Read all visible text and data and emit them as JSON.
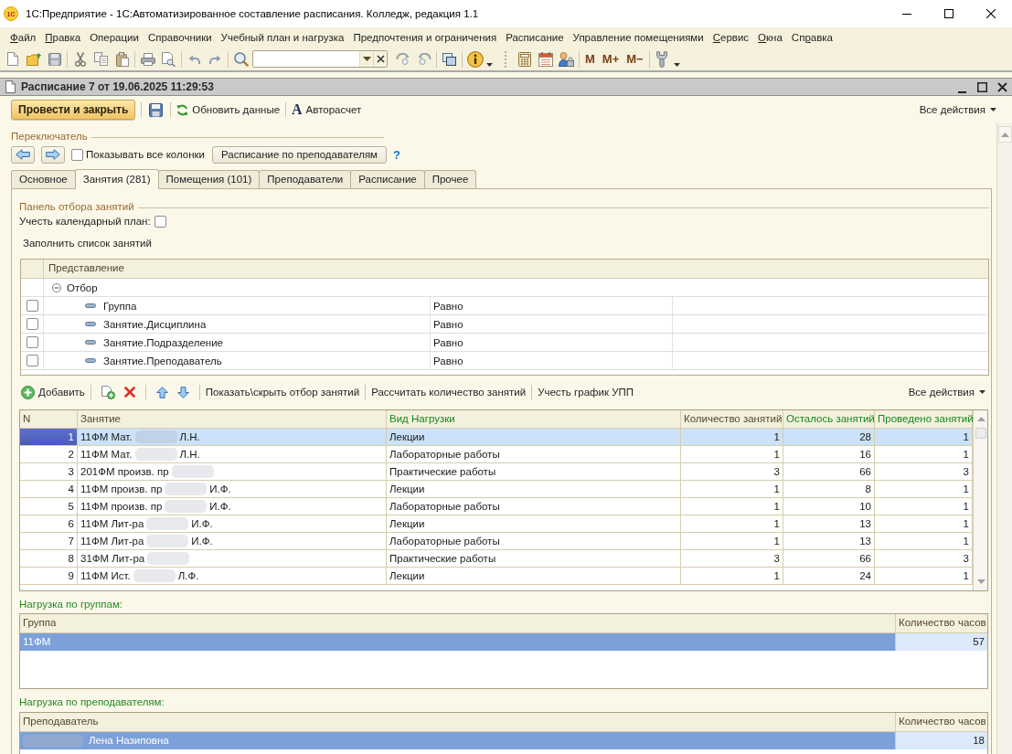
{
  "window": {
    "logo": "1С",
    "title": "1С:Предприятие - 1С:Автоматизированное составление расписания. Колледж, редакция 1.1"
  },
  "menu": [
    {
      "accel": "Ф",
      "rest": "айл"
    },
    {
      "accel": "П",
      "rest": "равка"
    },
    {
      "label": "Операции"
    },
    {
      "label": "Справочники"
    },
    {
      "label": "Учебный план и нагрузка"
    },
    {
      "label": "Предпочтения и ограничения"
    },
    {
      "label": "Расписание"
    },
    {
      "label": "Управление помещениями"
    },
    {
      "accel": "С",
      "rest": "ервис"
    },
    {
      "accel": "О",
      "rest": "кна"
    },
    {
      "lead": "Сп",
      "accel": "р",
      "rest": "авка"
    }
  ],
  "toolbar": {
    "memory_buttons": [
      "M",
      "M+",
      "M−"
    ]
  },
  "document": {
    "title": "Расписание 7 от 19.06.2025 11:29:53"
  },
  "command_bar": {
    "post_and_close": "Провести и закрыть",
    "refresh": "Обновить данные",
    "autocalc": {
      "glyph": "A",
      "label": "Авторасчет"
    },
    "all_actions": "Все действия"
  },
  "switcher": {
    "title": "Переключатель",
    "show_all_columns": {
      "label": "Показывать все колонки",
      "checked": false
    },
    "teacher_schedule": "Расписание по преподавателям",
    "help": "?"
  },
  "tabs": [
    {
      "label": "Основное",
      "selected": false
    },
    {
      "label": "Занятия (281)",
      "selected": true
    },
    {
      "label": "Помещения (101)",
      "selected": false
    },
    {
      "label": "Преподаватели",
      "selected": false
    },
    {
      "label": "Расписание",
      "selected": false
    },
    {
      "label": "Прочее",
      "selected": false
    }
  ],
  "filter_panel": {
    "title": "Панель отбора занятий",
    "calendar_plan": {
      "label": "Учесть календарный план:",
      "checked": false
    },
    "fill_button": "Заполнить список занятий",
    "table": {
      "columns": [
        "Представление"
      ],
      "group": {
        "label": "Отбор",
        "expanded": true
      },
      "rows": [
        {
          "checked": false,
          "field": "Группа",
          "comparison": "Равно"
        },
        {
          "checked": false,
          "field": "Занятие.Дисциплина",
          "comparison": "Равно"
        },
        {
          "checked": false,
          "field": "Занятие.Подразделение",
          "comparison": "Равно"
        },
        {
          "checked": false,
          "field": "Занятие.Преподаватель",
          "comparison": "Равно"
        }
      ]
    }
  },
  "lessons_toolbar": {
    "add": "Добавить",
    "show_hide": "Показать\\скрыть отбор занятий",
    "calculate": "Рассчитать количество занятий",
    "upp": "Учесть график УПП",
    "all_actions": "Все действия"
  },
  "lessons": {
    "columns": [
      {
        "label": "N",
        "color": "#54472c"
      },
      {
        "label": "Занятие",
        "color": "#54472c"
      },
      {
        "label": "Вид Нагрузки",
        "color": "#16891c"
      },
      {
        "label": "Количество занятий",
        "color": "#54472c"
      },
      {
        "label": "Осталось занятий",
        "color": "#16891c"
      },
      {
        "label": "Проведено занятий",
        "color": "#16891c"
      }
    ],
    "rows": [
      {
        "n": "1",
        "lesson": "11ФМ Мат.",
        "lesson_tail": "Л.Н.",
        "load_type": "Лекции",
        "count": "1",
        "remaining": "28",
        "done": "1",
        "selected": true
      },
      {
        "n": "2",
        "lesson": "11ФМ Мат.",
        "lesson_tail": "Л.Н.",
        "load_type": "Лабораторные работы",
        "count": "1",
        "remaining": "16",
        "done": "1",
        "selected": false
      },
      {
        "n": "3",
        "lesson": "201ФМ произв. пр",
        "load_type": "Практические работы",
        "count": "3",
        "remaining": "66",
        "done": "3",
        "selected": false
      },
      {
        "n": "4",
        "lesson": "11ФМ произв. пр",
        "lesson_tail": "И.Ф.",
        "load_type": "Лекции",
        "count": "1",
        "remaining": "8",
        "done": "1",
        "selected": false
      },
      {
        "n": "5",
        "lesson": "11ФМ произв. пр",
        "lesson_tail": "И.Ф.",
        "load_type": "Лабораторные работы",
        "count": "1",
        "remaining": "10",
        "done": "1",
        "selected": false
      },
      {
        "n": "6",
        "lesson": "11ФМ Лит-ра",
        "lesson_tail": "И.Ф.",
        "load_type": "Лекции",
        "count": "1",
        "remaining": "13",
        "done": "1",
        "selected": false
      },
      {
        "n": "7",
        "lesson": "11ФМ Лит-ра",
        "lesson_tail": "И.Ф.",
        "load_type": "Лабораторные работы",
        "count": "1",
        "remaining": "13",
        "done": "1",
        "selected": false
      },
      {
        "n": "8",
        "lesson": "31ФМ Лит-ра",
        "load_type": "Практические работы",
        "count": "3",
        "remaining": "66",
        "done": "3",
        "selected": false
      },
      {
        "n": "9",
        "lesson": "11ФМ Ист.",
        "lesson_tail": "Л.Ф.",
        "load_type": "Лекции",
        "count": "1",
        "remaining": "24",
        "done": "1",
        "selected": false
      }
    ]
  },
  "group_load": {
    "title": "Нагрузка по группам:",
    "columns": [
      "Группа",
      "Количество часов"
    ],
    "rows": [
      {
        "group": "11ФМ",
        "hours": "57",
        "selected": true
      }
    ]
  },
  "teacher_load": {
    "title": "Нагрузка по преподавателям:",
    "columns": [
      "Преподаватель",
      "Количество часов"
    ],
    "rows": [
      {
        "teacher": "Лена Назиповна",
        "hours": "18",
        "selected": true
      }
    ]
  }
}
